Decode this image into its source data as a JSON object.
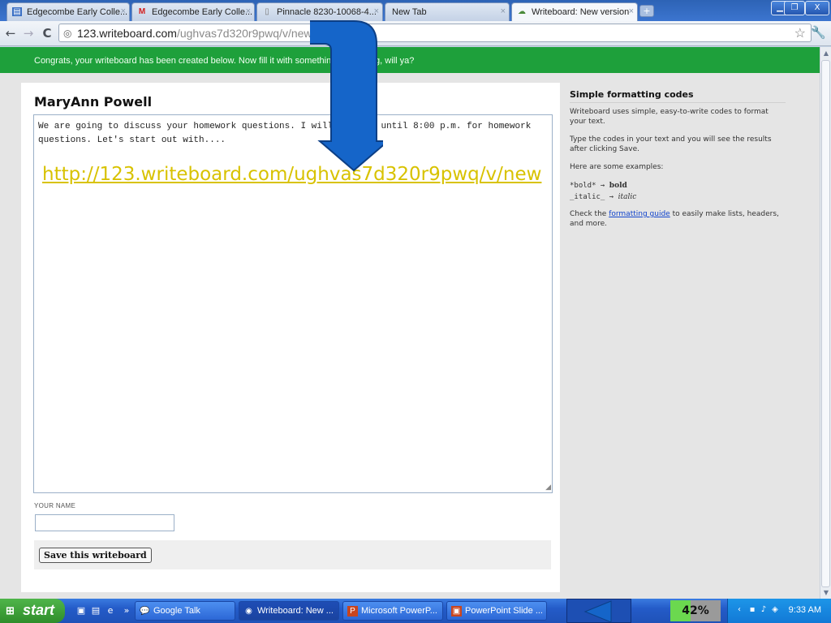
{
  "browser": {
    "tabs": [
      {
        "label": "Edgecombe Early Colle...",
        "icon": "page-icon"
      },
      {
        "label": "Edgecombe Early Colle...",
        "icon": "gmail-icon"
      },
      {
        "label": "Pinnacle 8230-10068-4...",
        "icon": "page-icon"
      },
      {
        "label": "New Tab",
        "icon": ""
      },
      {
        "label": "Writeboard: New version",
        "icon": "writeboard-icon"
      }
    ],
    "url_host": "123.writeboard.com",
    "url_path": "/ughvas7d320r9pwq/v/new"
  },
  "page": {
    "banner": "Congrats, your writeboard has been created below. Now fill it with something interesting, will ya?",
    "title": "MaryAnn Powell",
    "editor_text": "We are going to discuss your homework questions.  I will be here until 8:00 p.m. for homework questions.  Let's start out with....",
    "name_label": "YOUR NAME",
    "name_value": "",
    "save_label": "Save this writeboard",
    "overlay_url": "http://123.writeboard.com/ughvas7d320r9pwq/v/new"
  },
  "sidebar": {
    "heading": "Simple formatting codes",
    "p1": "Writeboard uses simple, easy-to-write codes to format your text.",
    "p2": "Type the codes in your text and you will see the results after clicking Save.",
    "p3": "Here are some examples:",
    "ex_bold_code": "*bold* →",
    "ex_bold_result": "bold",
    "ex_italic_code": "_italic_ →",
    "ex_italic_result": "italic",
    "p4_before": "Check the",
    "p4_link": "formatting guide",
    "p4_after": "to easily make lists, headers, and more."
  },
  "taskbar": {
    "start": "start",
    "tasks": [
      {
        "label": "Google Talk",
        "icon": "chat-icon"
      },
      {
        "label": "Writeboard: New ...",
        "icon": "chrome-icon"
      },
      {
        "label": "Microsoft PowerP...",
        "icon": "powerpoint-icon"
      },
      {
        "label": "PowerPoint Slide ...",
        "icon": "slideshow-icon"
      }
    ],
    "zoom": "42%",
    "clock": "9:33 AM"
  },
  "colors": {
    "banner": "#1ea03b",
    "overlay_url": "#d8c200",
    "arrow": "#1565c9"
  }
}
